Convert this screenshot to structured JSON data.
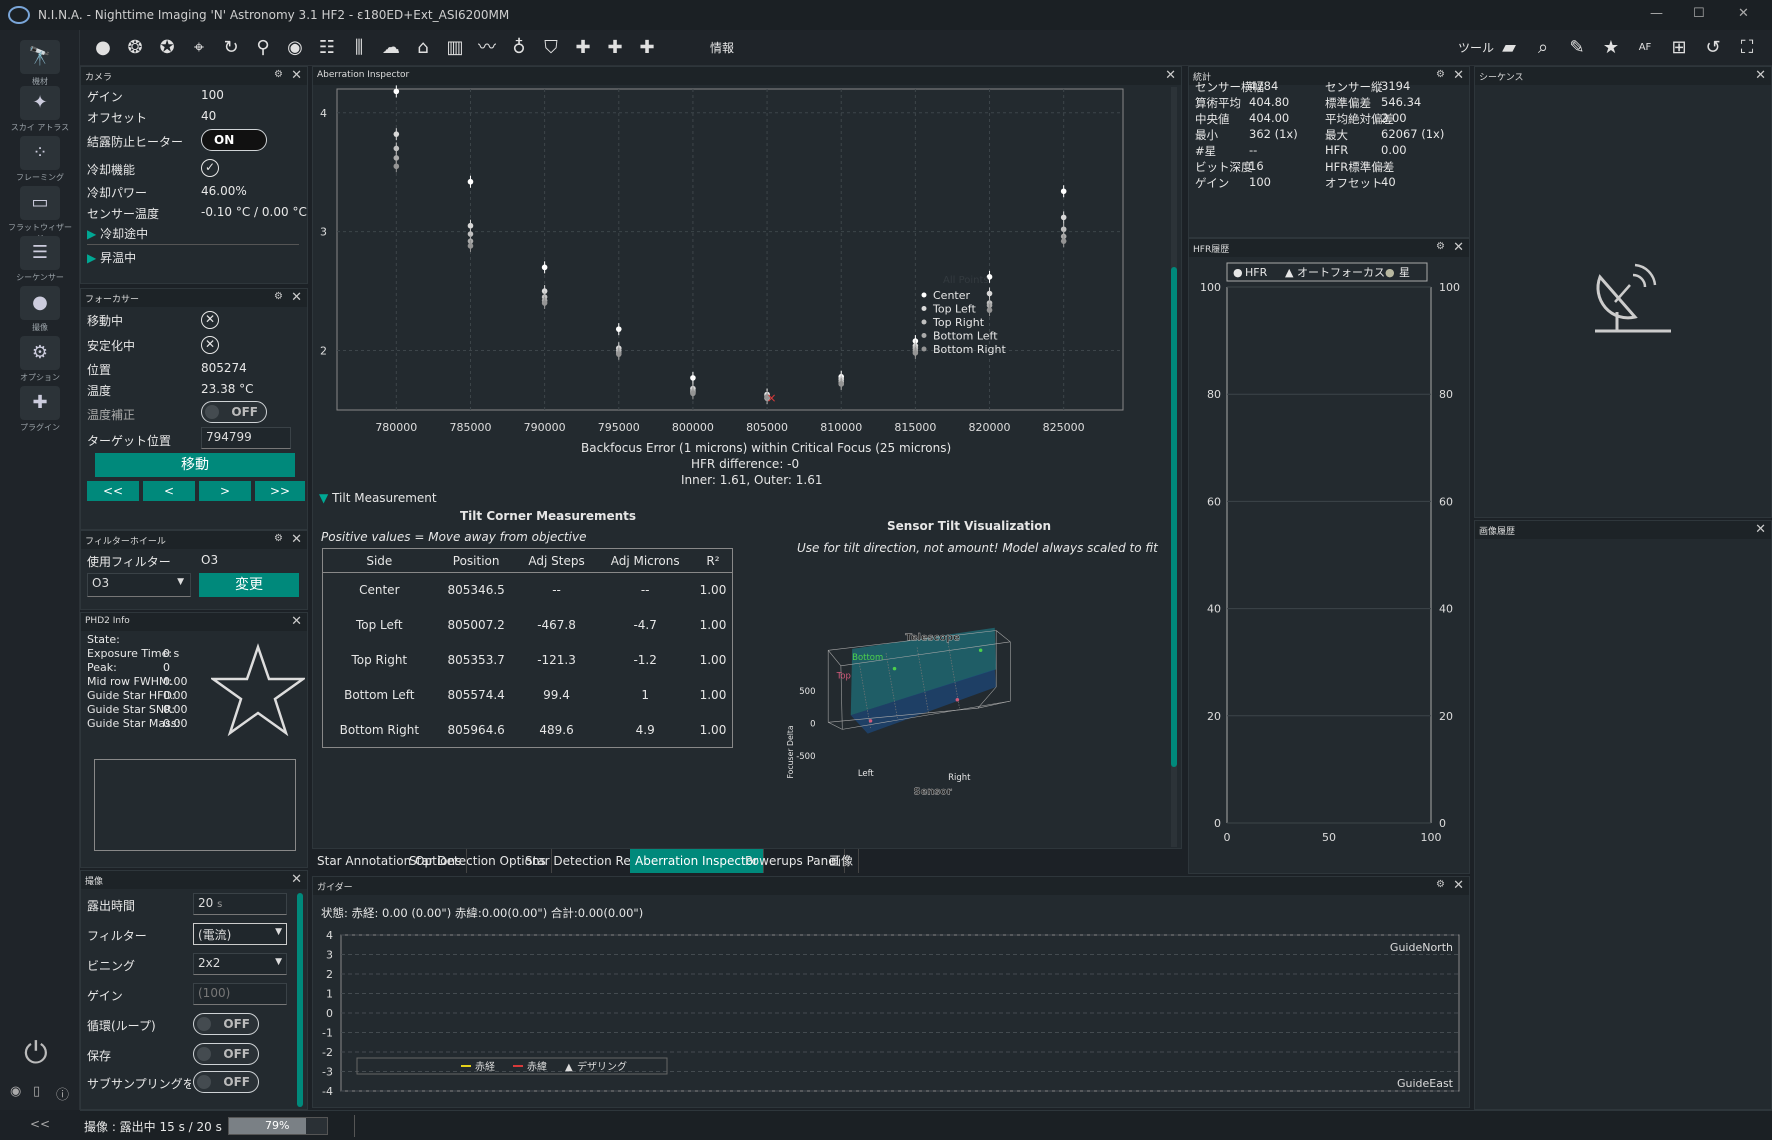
{
  "titlebar": {
    "title": "N.I.N.A. - Nighttime Imaging 'N' Astronomy 3.1 HF2   -  ε180ED+Ext_ASI6200MM",
    "min": "—",
    "max": "☐",
    "close": "✕"
  },
  "nav": [
    {
      "label": "機材",
      "icon": "telescope-icon",
      "glyph": "🔭"
    },
    {
      "label": "スカイ アトラス",
      "icon": "atlas-icon",
      "glyph": "✦"
    },
    {
      "label": "フレーミング",
      "icon": "framing-icon",
      "glyph": "⁘"
    },
    {
      "label": "フラットウィザード",
      "icon": "flat-wizard-icon",
      "glyph": "▭"
    },
    {
      "label": "シーケンサー",
      "icon": "sequencer-icon",
      "glyph": "☰"
    },
    {
      "label": "撮像",
      "icon": "imaging-icon",
      "glyph": "●"
    },
    {
      "label": "オプション",
      "icon": "gear-icon",
      "glyph": "⚙"
    },
    {
      "label": "プラグイン",
      "icon": "plugin-icon",
      "glyph": "✚"
    }
  ],
  "toolbar": {
    "info_label": "情報",
    "tools_label": "ツール"
  },
  "camera": {
    "title": "カメラ",
    "rows": [
      {
        "label": "ゲイン",
        "value": "100"
      },
      {
        "label": "オフセット",
        "value": "40"
      },
      {
        "label": "結露防止ヒーター",
        "value": "ON"
      },
      {
        "label": "冷却機能",
        "value": "✓"
      },
      {
        "label": "冷却パワー",
        "value": "46.00%"
      },
      {
        "label": "センサー温度",
        "value": "-0.10 °C / 0.00 °C"
      }
    ],
    "cooling": "冷却途中",
    "warming": "昇温中"
  },
  "focuser": {
    "title": "フォーカサー",
    "rows": [
      {
        "label": "移動中",
        "value": "✕"
      },
      {
        "label": "安定化中",
        "value": "✕"
      },
      {
        "label": "位置",
        "value": "805274"
      },
      {
        "label": "温度",
        "value": "23.38 °C"
      },
      {
        "label": "温度補正",
        "value": "OFF"
      },
      {
        "label": "ターゲット位置",
        "value": "794799"
      }
    ],
    "move": "移動",
    "steps": [
      "<<",
      "<",
      ">",
      ">>"
    ]
  },
  "filterwheel": {
    "title": "フィルターホイール",
    "current_label": "使用フィルター",
    "current": "O3",
    "select": "O3",
    "change": "変更"
  },
  "phd2": {
    "title": "PHD2 Info",
    "rows": [
      {
        "label": "State:",
        "value": ""
      },
      {
        "label": "Exposure Time:",
        "value": "0 s"
      },
      {
        "label": "Peak:",
        "value": "0"
      },
      {
        "label": "Mid row FWHM:",
        "value": "0.00"
      },
      {
        "label": "Guide Star HFD:",
        "value": "0.00"
      },
      {
        "label": "Guide Star SNR:",
        "value": "0.00"
      },
      {
        "label": "Guide Star Mass:",
        "value": "0.00"
      }
    ]
  },
  "imaging": {
    "title": "撮像",
    "rows": [
      {
        "label": "露出時間",
        "value": "20",
        "unit": "s"
      },
      {
        "label": "フィルター",
        "value": "(電流)"
      },
      {
        "label": "ビニング",
        "value": "2x2"
      },
      {
        "label": "ゲイン",
        "value": "(100)"
      },
      {
        "label": "循環(ループ)",
        "value": "OFF"
      },
      {
        "label": "保存",
        "value": "OFF"
      },
      {
        "label": "サブサンプリングをオン",
        "value": "OFF"
      }
    ]
  },
  "status": {
    "text": "撮像 :  露出中 15 s / 20 s",
    "progress": 0.79,
    "progress_label": "79%",
    "collapse": "<<"
  },
  "aberration": {
    "title": "Aberration Inspector",
    "caption1": "Backfocus Error (1 microns) within Critical Focus (25 microns)",
    "caption2": "HFR difference: -0",
    "caption3": "Inner: 1.61, Outer: 1.61",
    "legend_title": "All Points",
    "tilt_toggle": "Tilt Measurement",
    "table_title": "Tilt Corner Measurements",
    "table_note": "Positive values = Move away from objective",
    "viz_title": "Sensor Tilt Visualization",
    "viz_note": "Use for tilt direction, not amount! Model always scaled to fit",
    "viz_labels": {
      "telescope": "Telescope",
      "sensor": "Sensor",
      "bottom": "Bottom",
      "top": "Top",
      "left": "Left",
      "right": "Right",
      "zaxis": "Focuser Delta",
      "z500": "500",
      "z0": "0",
      "zm500": "-500"
    },
    "headers": [
      "Side",
      "Position",
      "Adj Steps",
      "Adj Microns",
      "R²"
    ],
    "rows": [
      [
        "Center",
        "805346.5",
        "--",
        "--",
        "1.00"
      ],
      [
        "Top Left",
        "805007.2",
        "-467.8",
        "-4.7",
        "1.00"
      ],
      [
        "Top Right",
        "805353.7",
        "-121.3",
        "-1.2",
        "1.00"
      ],
      [
        "Bottom Left",
        "805574.4",
        "99.4",
        "1",
        "1.00"
      ],
      [
        "Bottom Right",
        "805964.6",
        "489.6",
        "4.9",
        "1.00"
      ]
    ]
  },
  "chart_data": [
    {
      "type": "scatter",
      "title": "",
      "xlabel": "",
      "ylabel": "",
      "xlim": [
        776000,
        829000
      ],
      "ylim": [
        1.5,
        4.2
      ],
      "x_ticks": [
        "780000",
        "785000",
        "790000",
        "795000",
        "800000",
        "805000",
        "810000",
        "815000",
        "820000",
        "825000"
      ],
      "y_ticks": [
        "2",
        "3",
        "4"
      ],
      "series": [
        {
          "name": "Center",
          "x": [
            780000,
            785000,
            790000,
            795000,
            800000,
            805000,
            810000,
            815000,
            820000,
            825000
          ],
          "y": [
            4.18,
            3.42,
            2.7,
            2.18,
            1.77,
            1.63,
            1.78,
            2.08,
            2.62,
            3.34
          ]
        },
        {
          "name": "Top Left",
          "x": [
            780000,
            785000,
            790000,
            795000,
            800000,
            805000,
            810000,
            815000,
            820000,
            825000
          ],
          "y": [
            3.82,
            3.05,
            2.5,
            2.02,
            1.68,
            1.62,
            1.76,
            2.04,
            2.48,
            3.12
          ]
        },
        {
          "name": "Top Right",
          "x": [
            780000,
            785000,
            790000,
            795000,
            800000,
            805000,
            810000,
            815000,
            820000,
            825000
          ],
          "y": [
            3.7,
            2.98,
            2.45,
            2.0,
            1.66,
            1.6,
            1.74,
            2.02,
            2.4,
            3.02
          ]
        },
        {
          "name": "Bottom Left",
          "x": [
            780000,
            785000,
            790000,
            795000,
            800000,
            805000,
            810000,
            815000,
            820000,
            825000
          ],
          "y": [
            3.62,
            2.92,
            2.42,
            1.98,
            1.65,
            1.6,
            1.72,
            2.0,
            2.38,
            2.96
          ]
        },
        {
          "name": "Bottom Right",
          "x": [
            780000,
            785000,
            790000,
            795000,
            800000,
            805000,
            810000,
            815000,
            820000,
            825000
          ],
          "y": [
            3.55,
            2.88,
            2.4,
            1.97,
            1.64,
            1.61,
            1.72,
            1.98,
            2.34,
            2.92
          ]
        }
      ]
    },
    {
      "type": "line",
      "title": "",
      "xlabel": "",
      "ylabel": "",
      "xlim": [
        0,
        100
      ],
      "ylim": [
        0,
        100
      ],
      "x_ticks": [
        "0",
        "50",
        "100"
      ],
      "y_ticks": [
        "0",
        "20",
        "40",
        "60",
        "80",
        "100"
      ],
      "series": [],
      "legend": [
        "HFR",
        "オートフォーカス",
        "星"
      ]
    },
    {
      "type": "line",
      "title": "",
      "xlabel": "",
      "ylabel": "",
      "ylim": [
        -4,
        4
      ],
      "y_ticks": [
        "4",
        "3",
        "2",
        "1",
        "0",
        "-1",
        "-2",
        "-3",
        "-4"
      ],
      "series": [],
      "labels": {
        "north": "GuideNorth",
        "east": "GuideEast"
      },
      "legend": [
        "赤経",
        "赤緯",
        "デザリング"
      ]
    }
  ],
  "stats": {
    "title": "統計",
    "rows": [
      [
        "センサー横幅",
        "4784",
        "センサー縦",
        "3194"
      ],
      [
        "算術平均",
        "404.80",
        "標準偏差",
        "546.34"
      ],
      [
        "中央値",
        "404.00",
        "平均絶対偏差",
        "2.00"
      ],
      [
        "最小",
        "362 (1x)",
        "最大",
        "62067 (1x)"
      ],
      [
        "#星",
        "--",
        "HFR",
        "0.00"
      ],
      [
        "ビット深度",
        "16",
        "HFR標準偏差",
        "--"
      ],
      [
        "ゲイン",
        "100",
        "オフセット",
        "40"
      ]
    ]
  },
  "hfr": {
    "title": "HFR履歴"
  },
  "sequence": {
    "title": "シーケンス"
  },
  "image_history": {
    "title": "画像履歴"
  },
  "guider": {
    "title": "ガイダー",
    "status": "状態:  赤経: 0.00 (0.00\")  赤緯:0.00(0.00\")  合計:0.00(0.00\")"
  },
  "tabs": [
    "Star Annotation Options",
    "Star Detection Options",
    "Star Detection Results",
    "Aberration Inspector",
    "Powerups Panel",
    "画像"
  ],
  "colors": {
    "accent": "#00897b",
    "ra": "#e6d21a",
    "dec": "#d83a3a",
    "tilt_top": "#d05a7a",
    "tilt_bottom": "#4ccf4c"
  }
}
